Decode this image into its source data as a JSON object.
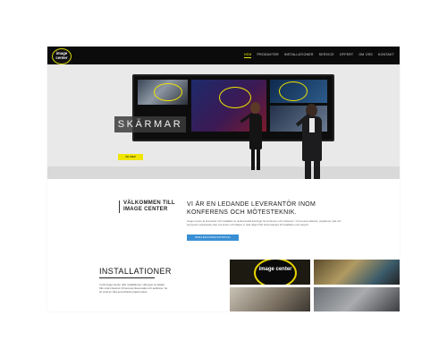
{
  "brand": {
    "logo_text": "image center"
  },
  "nav": {
    "items": [
      "HEM",
      "PRODUKTER",
      "INSTALLATIONER",
      "SERVICE",
      "OFFERT",
      "OM OSS",
      "KONTAKT"
    ],
    "active_index": 0
  },
  "hero": {
    "title": "SKÄRMAR",
    "button_label": "SE MER"
  },
  "welcome": {
    "title": "VÄLKOMMEN TILL IMAGE CENTER",
    "lead_title": "VI ÄR EN LEDANDE LEVERANTÖR INOM KONFERENS OCH MÖTESTEKNIK.",
    "lead_text": "Image Center är leverantör och installatör av audiovisuella lösningar för konferens och mötesrum. Vi levererar skärmar, projektorer, ljud och styrsystem anpassade efter era behov och hjälper er hela vägen från behovsanalys till installation och support.",
    "button_label": "BOKA EN KONSULTATION NU"
  },
  "installations": {
    "title": "INSTALLATIONER",
    "text": "Vi på Image Center utför installationer i alla typer av lokaler, från små mötesrum till stora konferenssalar och auditorier. Se ett urval av våra genomförda projekt nedan.",
    "badge_text": "image center"
  },
  "colors": {
    "accent": "#f0e500",
    "topbar": "#0b0b0b",
    "cta_blue": "#3a8fd4"
  }
}
